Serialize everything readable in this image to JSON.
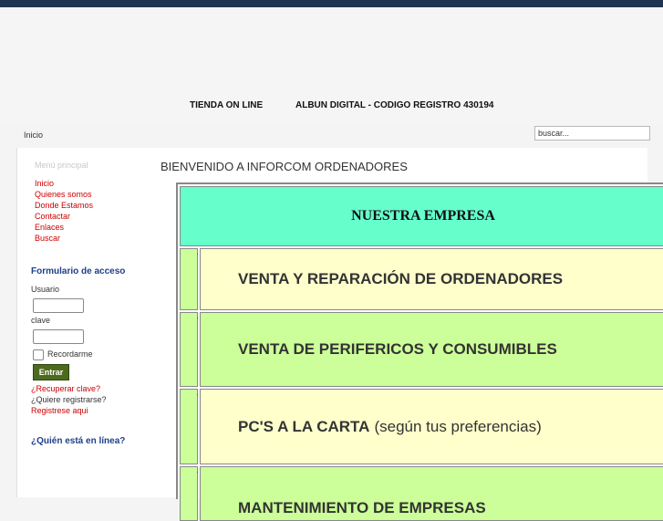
{
  "header": {
    "links": [
      "TIENDA ON LINE",
      "ALBUN DIGITAL - CODIGO REGISTRO 430194"
    ]
  },
  "breadcrumb": "Inicio",
  "search": {
    "value": "buscar..."
  },
  "sidebar": {
    "menu_title": "Menú principal",
    "menu_items": [
      "Inicio",
      "Quienes somos",
      "Donde Estamos",
      "Contactar",
      "Enlaces",
      "Buscar"
    ],
    "login": {
      "title": "Formulario de acceso",
      "username_label": "Usuario",
      "password_label": "clave",
      "remember_label": "Recordarme",
      "submit_label": "Entrar",
      "forgot_label": "¿Recuperar clave?",
      "register_question": "¿Quiere registrarse?",
      "register_link": "Registrese aqui"
    },
    "online_title": "¿Quién está en línea?"
  },
  "main": {
    "welcome": "BIENVENIDO A INFORCOM ORDENADORES",
    "panel_title": "NUESTRA EMPRESA",
    "rows": [
      {
        "title": "VENTA Y REPARACIÓN DE ORDENADORES",
        "extra": "",
        "bg": "#ffffcc"
      },
      {
        "title": "VENTA DE PERIFERICOS Y CONSUMIBLES",
        "extra": "",
        "bg": "#ccff99"
      },
      {
        "title": "PC'S A LA CARTA",
        "extra": "(según tus preferencias)",
        "bg": "#ffffcc"
      },
      {
        "title": "MANTENIMIENTO DE EMPRESAS",
        "extra": "",
        "bg": "#ccff99"
      }
    ]
  }
}
